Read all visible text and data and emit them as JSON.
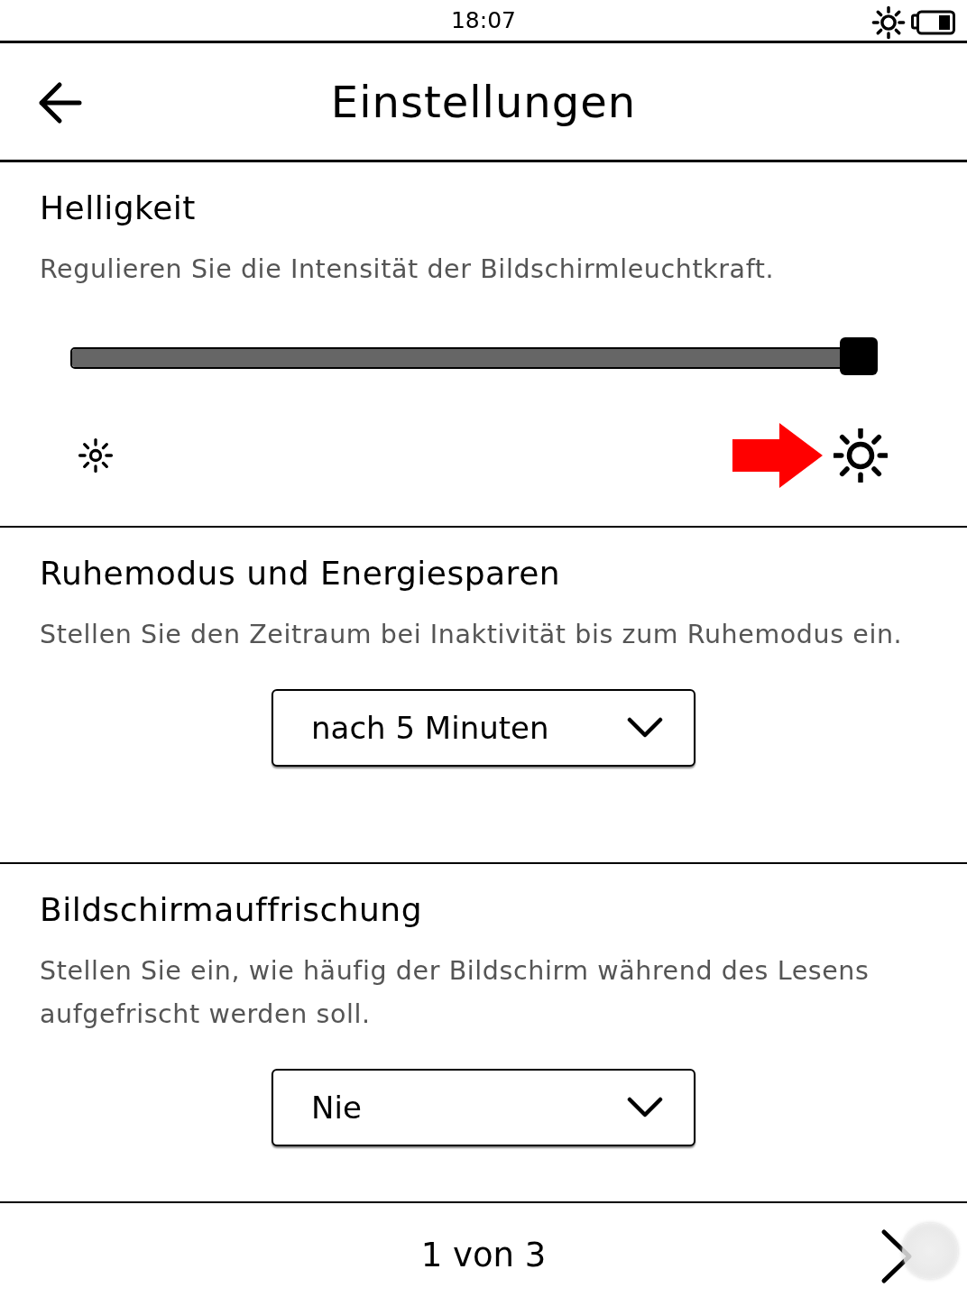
{
  "status_bar": {
    "time": "18:07"
  },
  "header": {
    "title": "Einstellungen"
  },
  "sections": [
    {
      "kind": "slider",
      "title": "Helligkeit",
      "description": "Regulieren Sie die Intensität der Bildschirmleuchtkraft.",
      "level": 1.0
    },
    {
      "kind": "dropdown",
      "title": "Ruhemodus und Energiesparen",
      "description": "Stellen Sie den Zeitraum bei Inaktivität bis zum Ruhemodus ein.",
      "value": "nach 5 Minuten"
    },
    {
      "kind": "dropdown",
      "title": "Bildschirmauffrischung",
      "description": "Stellen Sie ein, wie häufig der Bildschirm während des Lesens aufgefrischt werden soll.",
      "value": "Nie"
    }
  ],
  "footer": {
    "page": "1 von 3"
  }
}
